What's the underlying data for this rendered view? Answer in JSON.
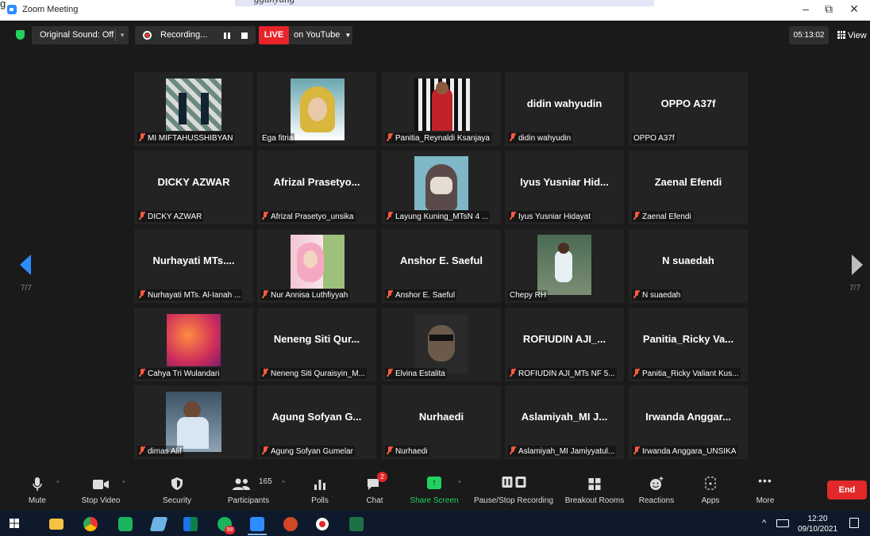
{
  "window": {
    "title": "Zoom Meeting",
    "stray_text": "g",
    "overlay_text": "ggunyang     ",
    "minimize": "–",
    "restore": "⧉",
    "close": "✕"
  },
  "topbar": {
    "original_sound": "Original Sound: Off",
    "recording": "Recording...",
    "live": "LIVE",
    "stream_target": "on YouTube",
    "timer": "05:13:02",
    "view": "View"
  },
  "pages": {
    "left": "7/7",
    "right": "7/7"
  },
  "tiles": [
    {
      "label": "MI MIFTAHUSSHIBYAN",
      "muted": true,
      "center": "",
      "photo": "photo1"
    },
    {
      "label": "Ega fitria",
      "muted": false,
      "center": "",
      "photo": "photo2"
    },
    {
      "label": "Panitia_Reynaldi Ksanjaya",
      "muted": true,
      "center": "",
      "photo": "photo3"
    },
    {
      "label": "didin wahyudin",
      "muted": true,
      "center": "didin wahyudin",
      "photo": ""
    },
    {
      "label": "OPPO A37f",
      "muted": false,
      "center": "OPPO A37f",
      "photo": ""
    },
    {
      "label": "DICKY AZWAR",
      "muted": true,
      "center": "DICKY AZWAR",
      "photo": ""
    },
    {
      "label": "Afrizal Prasetyo_unsika",
      "muted": true,
      "center": "Afrizal Prasetyo...",
      "photo": ""
    },
    {
      "label": "Layung Kuning_MTsN 4 ...",
      "muted": true,
      "center": "",
      "photo": "photo4"
    },
    {
      "label": "Iyus Yusniar Hidayat",
      "muted": true,
      "center": "Iyus Yusniar Hid...",
      "photo": ""
    },
    {
      "label": "Zaenal Efendi",
      "muted": true,
      "center": "Zaenal Efendi",
      "photo": ""
    },
    {
      "label": "Nurhayati MTs. Al-Ianah ...",
      "muted": true,
      "center": "Nurhayati MTs....",
      "photo": ""
    },
    {
      "label": "Nur Annisa Luthfiyyah",
      "muted": true,
      "center": "",
      "photo": "photo5"
    },
    {
      "label": "Anshor E. Saeful",
      "muted": true,
      "center": "Anshor E. Saeful",
      "photo": ""
    },
    {
      "label": "Chepy RH",
      "muted": false,
      "center": "",
      "photo": "photo6"
    },
    {
      "label": "N suaedah",
      "muted": true,
      "center": "N suaedah",
      "photo": ""
    },
    {
      "label": "Cahya Tri Wulandari",
      "muted": true,
      "center": "",
      "photo": "photo7"
    },
    {
      "label": "Neneng Siti Quraisyin_M...",
      "muted": true,
      "center": "Neneng Siti Qur...",
      "photo": ""
    },
    {
      "label": "Elvina Estalita",
      "muted": true,
      "center": "",
      "photo": "photo8"
    },
    {
      "label": "ROFIUDIN AJI_MTs NF 5...",
      "muted": true,
      "center": "ROFIUDIN AJI_...",
      "photo": ""
    },
    {
      "label": "Panitia_Ricky Valiant Kus...",
      "muted": true,
      "center": "Panitia_Ricky Va...",
      "photo": ""
    },
    {
      "label": "dimas Alif",
      "muted": true,
      "center": "",
      "photo": "photo9"
    },
    {
      "label": "Agung Sofyan Gumelar",
      "muted": true,
      "center": "Agung Sofyan G...",
      "photo": ""
    },
    {
      "label": "Nurhaedi",
      "muted": true,
      "center": "Nurhaedi",
      "photo": ""
    },
    {
      "label": "Aslamiyah_MI Jamiyyatul...",
      "muted": true,
      "center": "Aslamiyah_MI J...",
      "photo": ""
    },
    {
      "label": "Irwanda Anggara_UNSIKA",
      "muted": true,
      "center": "Irwanda Anggar...",
      "photo": ""
    }
  ],
  "toolbar": {
    "mute": "Mute",
    "stop_video": "Stop Video",
    "security": "Security",
    "participants": "Participants",
    "participants_count": "165",
    "polls": "Polls",
    "chat": "Chat",
    "chat_badge": "2",
    "share_screen": "Share Screen",
    "pause_recording": "Pause/Stop Recording",
    "breakout_rooms": "Breakout Rooms",
    "reactions": "Reactions",
    "apps": "Apps",
    "more": "More",
    "end": "End"
  },
  "taskbar": {
    "whatsapp_badge": "99",
    "time": "12:20",
    "date": "09/10/2021"
  },
  "colors": {
    "accent": "#2d8cff",
    "live_red": "#e8242a",
    "end_red": "#e22828",
    "muted_red": "#ff5b3e",
    "share_green": "#23d160"
  }
}
